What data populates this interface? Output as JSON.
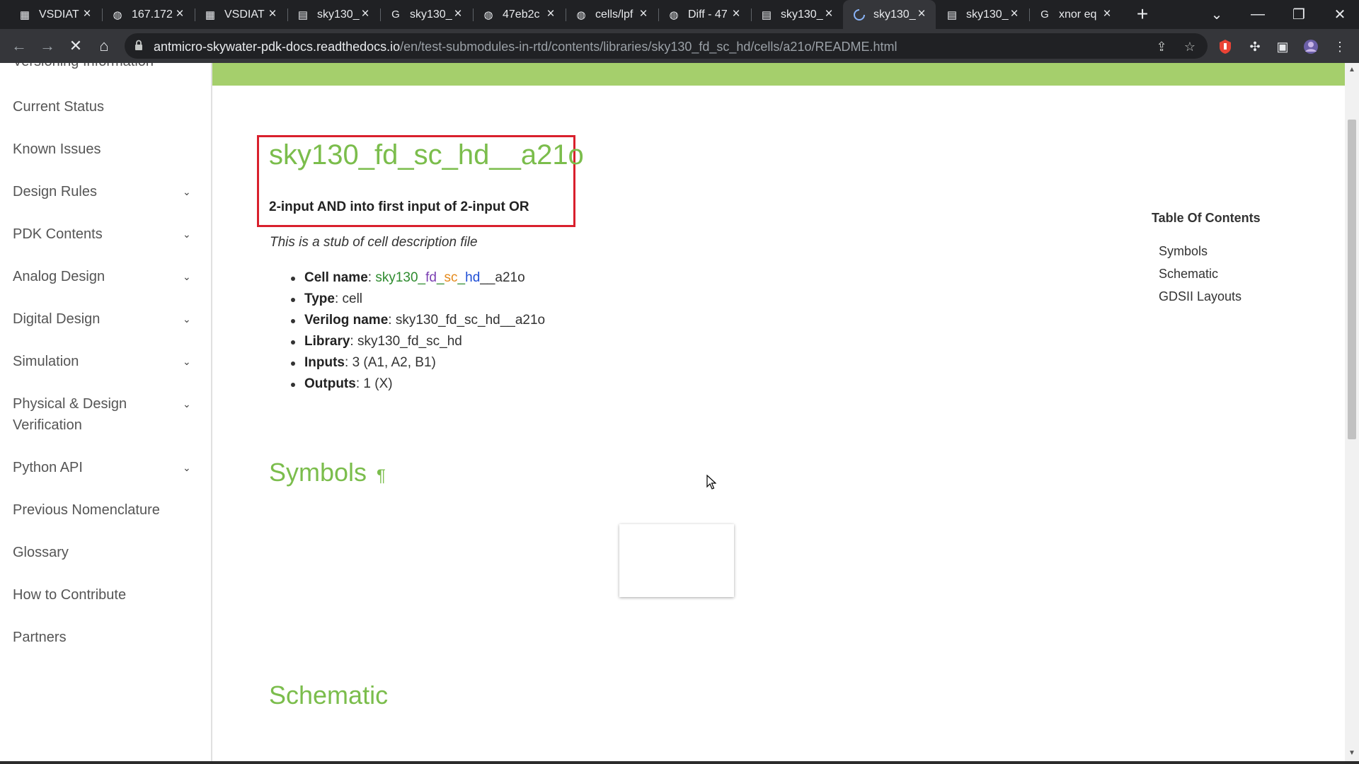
{
  "browser": {
    "tabs": [
      {
        "title": "VSDIAT",
        "icon": "vsd-icon",
        "active": false
      },
      {
        "title": "167.172",
        "icon": "globe-icon",
        "active": false
      },
      {
        "title": "VSDIAT",
        "icon": "vsd-icon",
        "active": false
      },
      {
        "title": "sky130_",
        "icon": "docs-icon",
        "active": false
      },
      {
        "title": "sky130_",
        "icon": "google-icon",
        "active": false
      },
      {
        "title": "47eb2c",
        "icon": "globe-icon",
        "active": false
      },
      {
        "title": "cells/lpf",
        "icon": "globe-icon",
        "active": false
      },
      {
        "title": "Diff - 47",
        "icon": "globe-icon",
        "active": false
      },
      {
        "title": "sky130_",
        "icon": "docs-icon",
        "active": false
      },
      {
        "title": "sky130_",
        "icon": "loading-spinner-icon",
        "active": true
      },
      {
        "title": "sky130_",
        "icon": "docs-icon",
        "active": false
      },
      {
        "title": "xnor eq",
        "icon": "google-icon",
        "active": false
      }
    ],
    "url_host": "antmicro-skywater-pdk-docs.readthedocs.io",
    "url_path": "/en/test-submodules-in-rtd/contents/libraries/sky130_fd_sc_hd/cells/a21o/README.html"
  },
  "sidebar": {
    "items": [
      {
        "label": "Versioning Information",
        "expandable": false
      },
      {
        "label": "Current Status",
        "expandable": false
      },
      {
        "label": "Known Issues",
        "expandable": false
      },
      {
        "label": "Design Rules",
        "expandable": true
      },
      {
        "label": "PDK Contents",
        "expandable": true
      },
      {
        "label": "Analog Design",
        "expandable": true
      },
      {
        "label": "Digital Design",
        "expandable": true
      },
      {
        "label": "Simulation",
        "expandable": true
      },
      {
        "label": "Physical & Design",
        "label2": "Verification",
        "expandable": true
      },
      {
        "label": "Python API",
        "expandable": true
      },
      {
        "label": "Previous Nomenclature",
        "expandable": false
      },
      {
        "label": "Glossary",
        "expandable": false
      },
      {
        "label": "How to Contribute",
        "expandable": false
      },
      {
        "label": "Partners",
        "expandable": false
      }
    ]
  },
  "main": {
    "title": "sky130_fd_sc_hd__a21o",
    "subtitle": "2-input AND into first input of 2-input OR",
    "stub_note": "This is a stub of cell description file",
    "properties": {
      "cell_name_label": "Cell name",
      "cell_name_parts": [
        "sky130",
        "_",
        "fd",
        "_",
        "sc",
        "_",
        "hd",
        "__a21o"
      ],
      "type_label": "Type",
      "type_value": "cell",
      "verilog_label": "Verilog name",
      "verilog_value": "sky130_fd_sc_hd__a21o",
      "library_label": "Library",
      "library_value": "sky130_fd_sc_hd",
      "inputs_label": "Inputs",
      "inputs_value": "3 (A1, A2, B1)",
      "outputs_label": "Outputs",
      "outputs_value": "1 (X)"
    },
    "symbols_heading": "Symbols",
    "pilcrow": "¶",
    "schematic_heading": "Schematic"
  },
  "toc": {
    "title": "Table Of Contents",
    "items": [
      "Symbols",
      "Schematic",
      "GDSII Layouts"
    ]
  },
  "colors": {
    "accent_green": "#7bbd4c",
    "header_bar": "#a5cf6c",
    "highlight_box": "#d9202d"
  }
}
